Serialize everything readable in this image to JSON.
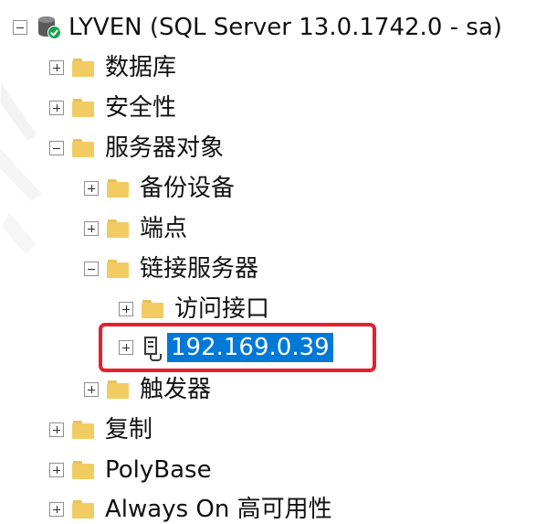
{
  "tree": {
    "root": {
      "label": "LYVEN (SQL Server 13.0.1742.0 - sa)",
      "state": "expanded",
      "icon": "server-connected-icon"
    },
    "items": [
      {
        "label": "数据库",
        "state": "collapsed",
        "icon": "folder-icon"
      },
      {
        "label": "安全性",
        "state": "collapsed",
        "icon": "folder-icon"
      },
      {
        "label": "服务器对象",
        "state": "expanded",
        "icon": "folder-icon",
        "children": [
          {
            "label": "备份设备",
            "state": "collapsed",
            "icon": "folder-icon"
          },
          {
            "label": "端点",
            "state": "collapsed",
            "icon": "folder-icon"
          },
          {
            "label": "链接服务器",
            "state": "expanded",
            "icon": "folder-icon",
            "children": [
              {
                "label": "访问接口",
                "state": "collapsed",
                "icon": "folder-icon"
              },
              {
                "label": "192.169.0.39",
                "state": "collapsed",
                "icon": "linked-server-icon",
                "selected": true
              }
            ]
          },
          {
            "label": "触发器",
            "state": "collapsed",
            "icon": "folder-icon"
          }
        ]
      },
      {
        "label": "复制",
        "state": "collapsed",
        "icon": "folder-icon"
      },
      {
        "label": "PolyBase",
        "state": "collapsed",
        "icon": "folder-icon"
      },
      {
        "label": "Always On 高可用性",
        "state": "collapsed",
        "icon": "folder-icon"
      }
    ]
  },
  "colors": {
    "selection": "#0078d7",
    "highlight_box": "#e8202e",
    "folder": "#f2cc62"
  }
}
